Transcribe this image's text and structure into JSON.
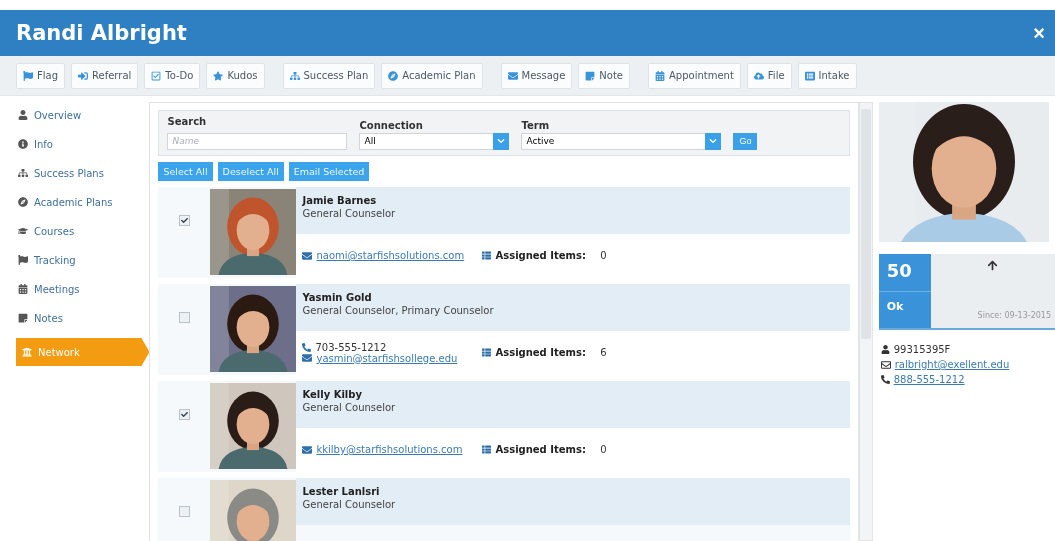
{
  "window": {
    "title": "Randi Albright",
    "close": "×"
  },
  "toolbar": [
    [
      {
        "label": "Flag"
      },
      {
        "label": "Referral"
      },
      {
        "label": "To-Do"
      },
      {
        "label": "Kudos"
      }
    ],
    [
      {
        "label": "Success Plan"
      },
      {
        "label": "Academic Plan"
      }
    ],
    [
      {
        "label": "Message"
      },
      {
        "label": "Note"
      }
    ],
    [
      {
        "label": "Appointment"
      },
      {
        "label": "File"
      },
      {
        "label": "Intake"
      }
    ]
  ],
  "sidebar": {
    "items": [
      {
        "label": "Overview",
        "selected": false
      },
      {
        "label": "Info",
        "selected": false
      },
      {
        "label": "Success Plans",
        "selected": false
      },
      {
        "label": "Academic Plans",
        "selected": false
      },
      {
        "label": "Courses",
        "selected": false
      },
      {
        "label": "Tracking",
        "selected": false
      },
      {
        "label": "Meetings",
        "selected": false
      },
      {
        "label": "Notes",
        "selected": false
      },
      {
        "label": "Network",
        "selected": true
      }
    ]
  },
  "filters": {
    "search": {
      "label": "Search",
      "placeholder": "Name"
    },
    "connection": {
      "label": "Connection",
      "value": "All"
    },
    "term": {
      "label": "Term",
      "value": "Active"
    },
    "go": "Go"
  },
  "actions": [
    "Select All",
    "Deselect All",
    "Email Selected"
  ],
  "contacts": [
    {
      "name": "Jamie Barnes",
      "role": "General Counselor",
      "checked": true,
      "email": "naomi@starfishsolutions.com",
      "assigned_label": "Assigned Items:",
      "assigned": "0"
    },
    {
      "name": "Yasmin Gold",
      "role": "General Counselor, Primary Counselor",
      "checked": false,
      "phone": "703-555-1212",
      "email": "yasmin@starfishsollege.edu",
      "assigned_label": "Assigned Items:",
      "assigned": "6"
    },
    {
      "name": "Kelly Kilby",
      "role": "General Counselor",
      "checked": true,
      "email": "kkilby@starfishsolutions.com",
      "assigned_label": "Assigned Items:",
      "assigned": "0"
    },
    {
      "name": "Lester Lanlsri",
      "role": "General Counselor",
      "checked": false
    }
  ],
  "profile": {
    "score": "50",
    "status": "Ok",
    "since": "Since: 09-13-2015",
    "student_id": "99315395F",
    "email": "ralbright@exellent.edu",
    "phone": "888-555-1212"
  }
}
